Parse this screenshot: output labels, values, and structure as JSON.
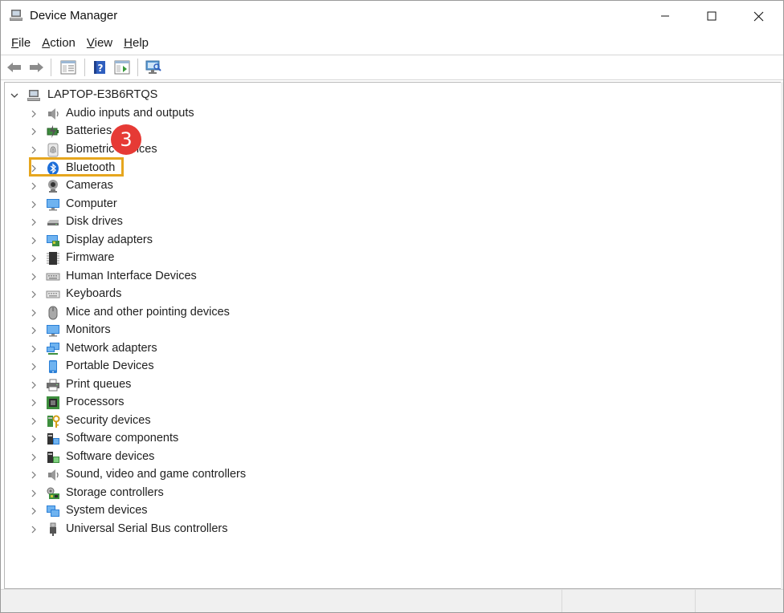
{
  "window": {
    "title": "Device Manager"
  },
  "menu": [
    {
      "pre": "",
      "u": "F",
      "post": "ile"
    },
    {
      "pre": "",
      "u": "A",
      "post": "ction"
    },
    {
      "pre": "",
      "u": "V",
      "post": "iew"
    },
    {
      "pre": "",
      "u": "H",
      "post": "elp"
    }
  ],
  "tree": {
    "root": "LAPTOP-E3B6RTQS",
    "items": [
      {
        "label": "Audio inputs and outputs",
        "icon": "speaker-icon"
      },
      {
        "label": "Batteries",
        "icon": "battery-icon"
      },
      {
        "label": "Biometric devices",
        "icon": "fingerprint-icon"
      },
      {
        "label": "Bluetooth",
        "icon": "bluetooth-icon"
      },
      {
        "label": "Cameras",
        "icon": "camera-icon"
      },
      {
        "label": "Computer",
        "icon": "computer-icon"
      },
      {
        "label": "Disk drives",
        "icon": "disk-drive-icon"
      },
      {
        "label": "Display adapters",
        "icon": "display-adapter-icon"
      },
      {
        "label": "Firmware",
        "icon": "firmware-chip-icon"
      },
      {
        "label": "Human Interface Devices",
        "icon": "hid-icon"
      },
      {
        "label": "Keyboards",
        "icon": "keyboard-icon"
      },
      {
        "label": "Mice and other pointing devices",
        "icon": "mouse-icon"
      },
      {
        "label": "Monitors",
        "icon": "monitor-icon"
      },
      {
        "label": "Network adapters",
        "icon": "network-adapter-icon"
      },
      {
        "label": "Portable Devices",
        "icon": "portable-device-icon"
      },
      {
        "label": "Print queues",
        "icon": "printer-icon"
      },
      {
        "label": "Processors",
        "icon": "processor-icon"
      },
      {
        "label": "Security devices",
        "icon": "security-device-icon"
      },
      {
        "label": "Software components",
        "icon": "software-component-icon"
      },
      {
        "label": "Software devices",
        "icon": "software-device-icon"
      },
      {
        "label": "Sound, video and game controllers",
        "icon": "sound-controller-icon"
      },
      {
        "label": "Storage controllers",
        "icon": "storage-controller-icon"
      },
      {
        "label": "System devices",
        "icon": "system-device-icon"
      },
      {
        "label": "Universal Serial Bus controllers",
        "icon": "usb-icon"
      }
    ]
  },
  "annotation": {
    "step": "3",
    "highlight_color": "#e6a61e",
    "badge_color": "#e63a35"
  }
}
